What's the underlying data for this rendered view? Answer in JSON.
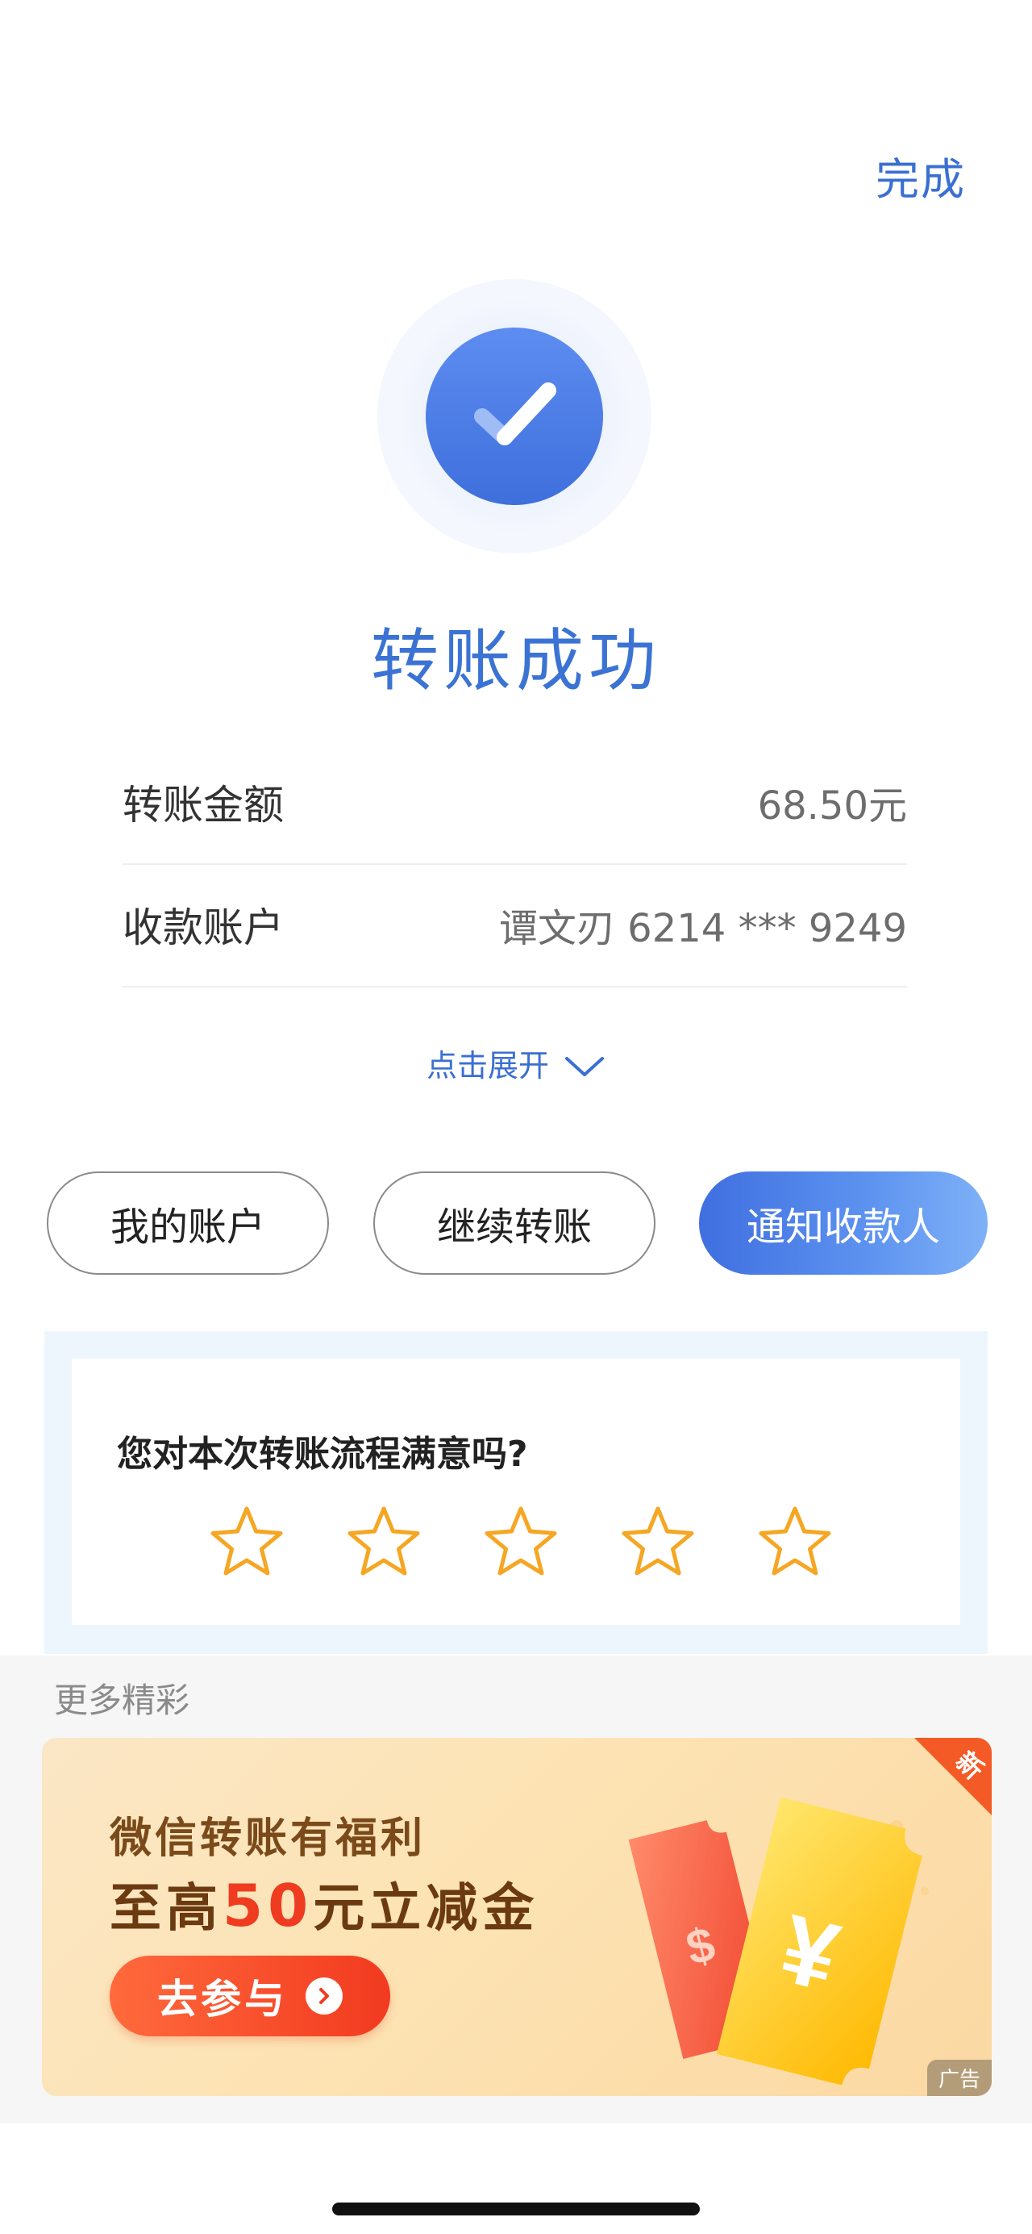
{
  "header": {
    "done_label": "完成"
  },
  "status": {
    "title": "转账成功"
  },
  "details": [
    {
      "label": "转账金额",
      "value": "68.50元"
    },
    {
      "label": "收款账户",
      "value": "谭文刃 6214 *** 9249"
    }
  ],
  "expand_label": "点击展开",
  "actions": {
    "my_account": "我的账户",
    "continue_transfer": "继续转账",
    "notify_payee": "通知收款人"
  },
  "rating": {
    "question": "您对本次转账流程满意吗?",
    "stars_total": 5,
    "selected": 0
  },
  "more": {
    "title": "更多精彩"
  },
  "ad": {
    "line1": "微信转账有福利",
    "line2_prefix": "至高",
    "line2_highlight": "50",
    "line2_suffix": "元立减金",
    "cta": "去参与",
    "badge": "新",
    "tag": "广告"
  },
  "colors": {
    "accent": "#3b73d4",
    "star": "#f5a623",
    "ad_highlight": "#ef3b1f"
  }
}
